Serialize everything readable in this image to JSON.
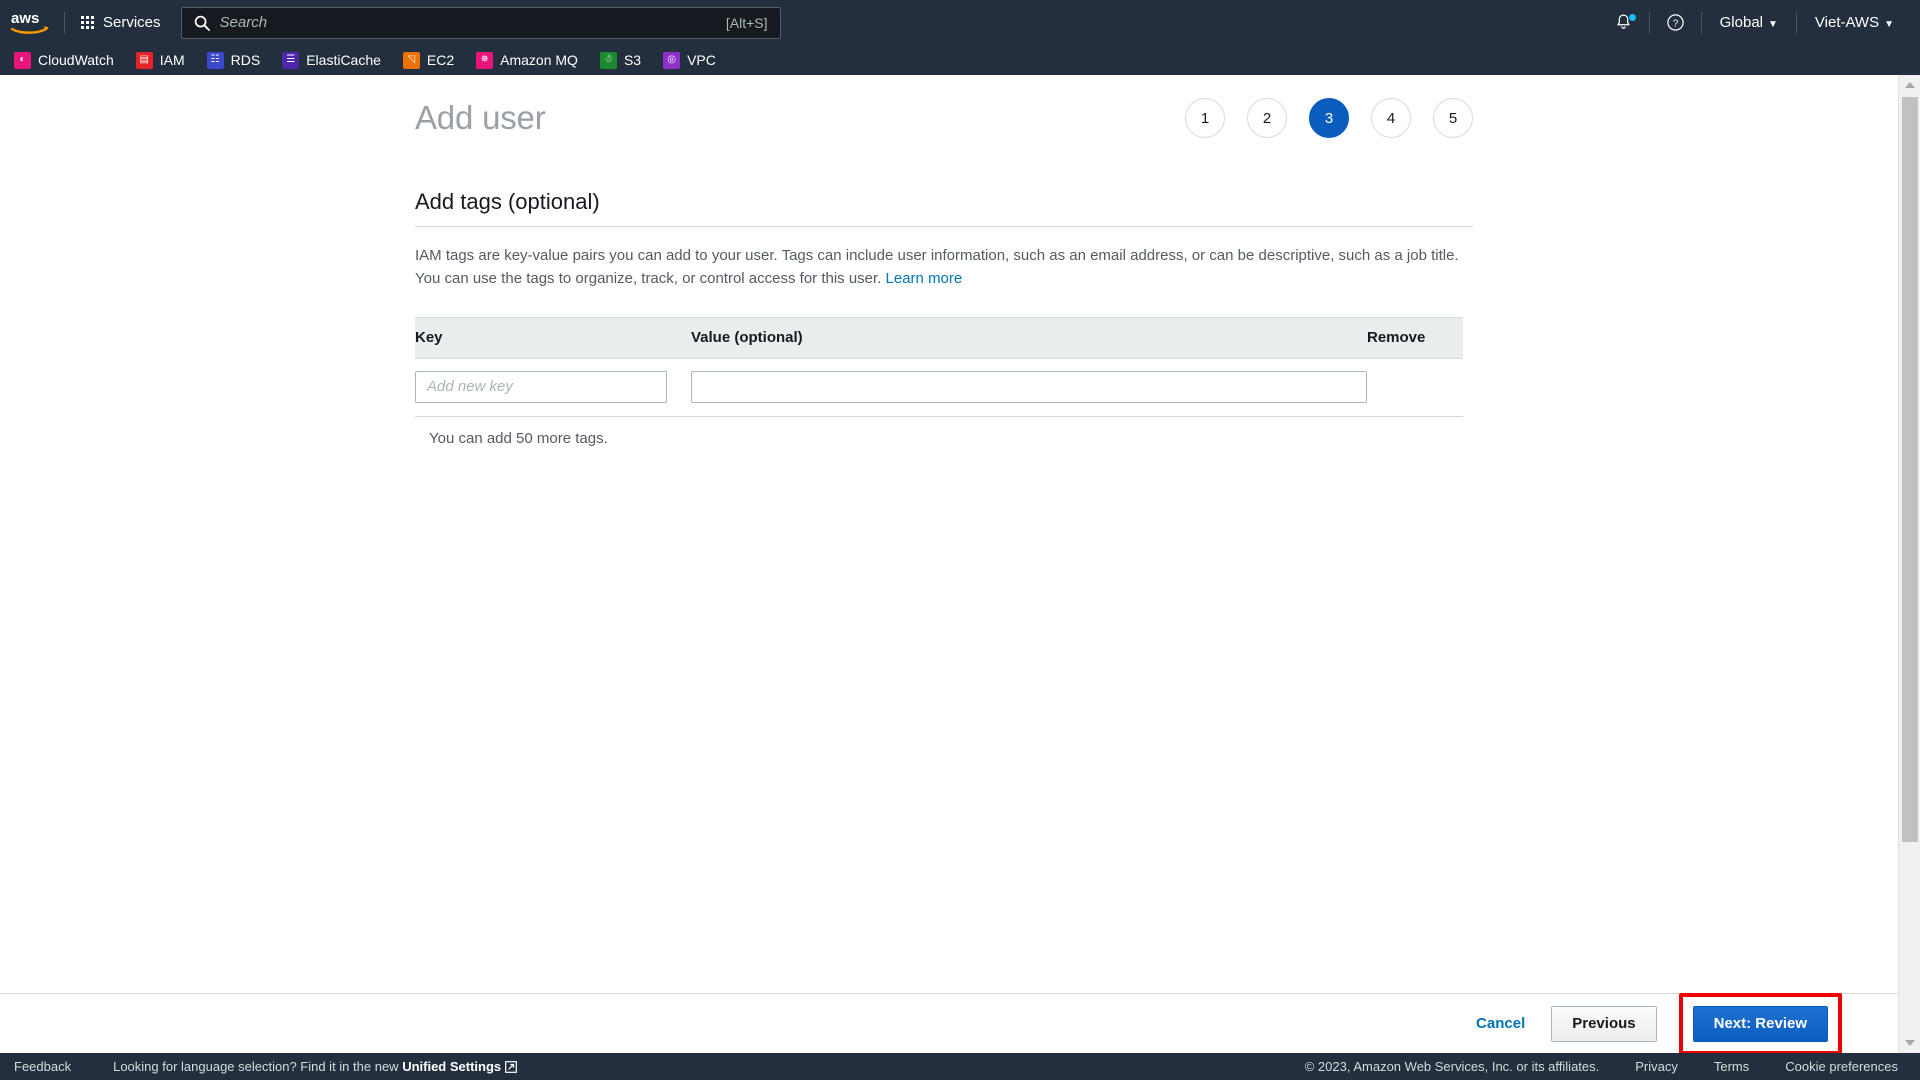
{
  "topnav": {
    "logo_alt": "aws",
    "services_label": "Services",
    "search": {
      "placeholder": "Search",
      "value": "",
      "shortcut_hint": "[Alt+S]"
    },
    "notifications_icon": "bell-icon",
    "help_icon": "question-circle-icon",
    "region_label": "Global",
    "account_label": "Viet-AWS",
    "caret": "▼"
  },
  "shortcuts": [
    {
      "label": "CloudWatch",
      "icon": "cloudwatch-icon",
      "color": "#e7157b",
      "glyph": "◔"
    },
    {
      "label": "IAM",
      "icon": "iam-icon",
      "color": "#e8222a",
      "glyph": "▤"
    },
    {
      "label": "RDS",
      "icon": "rds-icon",
      "color": "#3b48cc",
      "glyph": "☷"
    },
    {
      "label": "ElastiCache",
      "icon": "elasticache-icon",
      "color": "#4d27a8",
      "glyph": "☰"
    },
    {
      "label": "EC2",
      "icon": "ec2-icon",
      "color": "#ed7100",
      "glyph": "◱"
    },
    {
      "label": "Amazon MQ",
      "icon": "amazon-mq-icon",
      "color": "#e7157b",
      "glyph": "✵"
    },
    {
      "label": "S3",
      "icon": "s3-icon",
      "color": "#1b8a2f",
      "glyph": "⛃"
    },
    {
      "label": "VPC",
      "icon": "vpc-icon",
      "color": "#8c32c9",
      "glyph": "◎"
    }
  ],
  "main": {
    "page_title": "Add user",
    "steps": [
      {
        "number": "1",
        "active": false
      },
      {
        "number": "2",
        "active": false
      },
      {
        "number": "3",
        "active": true
      },
      {
        "number": "4",
        "active": false
      },
      {
        "number": "5",
        "active": false
      }
    ],
    "active_step": 3,
    "total_steps": 5,
    "section_heading": "Add tags (optional)",
    "description_text": "IAM tags are key-value pairs you can add to your user. Tags can include user information, such as an email address, or can be descriptive, such as a job title. You can use the tags to organize, track, or control access for this user. ",
    "learn_more_label": "Learn more",
    "table": {
      "headers": {
        "key": "Key",
        "value": "Value (optional)",
        "remove": "Remove"
      },
      "rows": [
        {
          "key_value": "",
          "key_placeholder": "Add new key",
          "value_value": "",
          "value_placeholder": ""
        }
      ]
    },
    "tags_note": "You can add 50 more tags."
  },
  "actions": {
    "cancel_label": "Cancel",
    "previous_label": "Previous",
    "next_label": "Next: Review",
    "highlight_color": "#ee0000"
  },
  "footer": {
    "feedback_label": "Feedback",
    "language_prompt": "Looking for language selection? Find it in the new ",
    "unified_settings_label": "Unified Settings",
    "external_link_icon": "external-link-icon",
    "copyright": "© 2023, Amazon Web Services, Inc. or its affiliates.",
    "privacy_label": "Privacy",
    "terms_label": "Terms",
    "cookie_label": "Cookie preferences"
  },
  "colors": {
    "nav_background": "#232f3e",
    "accent_blue": "#0073bb",
    "primary_button": "#0b5ec1",
    "active_step": "#0a5dbd",
    "table_header": "#eaeded",
    "border": "#d5dbdb"
  }
}
